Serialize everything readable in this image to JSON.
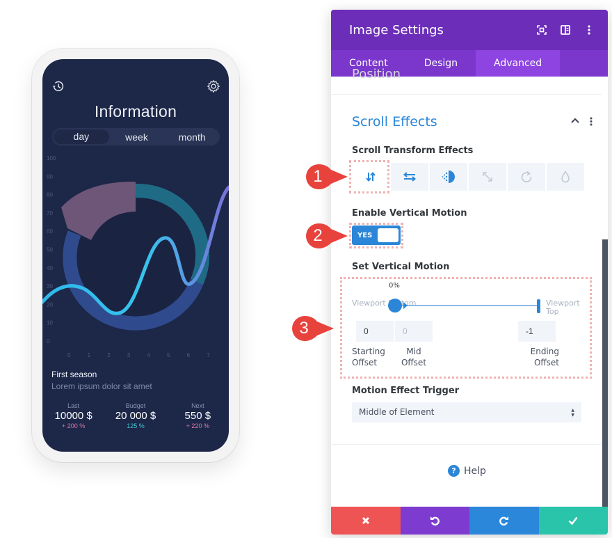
{
  "phone": {
    "title": "Information",
    "icons": {
      "left": "history-icon",
      "right": "gear-icon"
    },
    "segments": [
      {
        "label": "day",
        "active": true
      },
      {
        "label": "week",
        "active": false
      },
      {
        "label": "month",
        "active": false
      }
    ],
    "chart": {
      "y_ticks": [
        "100",
        "90",
        "80",
        "70",
        "60",
        "50",
        "40",
        "30",
        "20",
        "10",
        "0"
      ],
      "x_ticks": [
        "0",
        "1",
        "2",
        "3",
        "4",
        "5",
        "6",
        "7"
      ]
    },
    "season_title": "First season",
    "season_sub": "Lorem ipsum dolor sit amet",
    "stats": [
      {
        "label": "Last",
        "value": "10000 $",
        "change": "+ 200 %",
        "color": "#d97aa8"
      },
      {
        "label": "Budget",
        "value": "20 000 $",
        "change": "125 %",
        "color": "#3fc6d6"
      },
      {
        "label": "Next",
        "value": "550 $",
        "change": "+ 220 %",
        "color": "#d97aa8"
      }
    ]
  },
  "panel": {
    "title": "Image Settings",
    "header_icons": [
      "expand-icon",
      "sidebar-layout-icon",
      "more-vertical-icon"
    ],
    "tabs": [
      {
        "label": "Content",
        "active": false
      },
      {
        "label": "Design",
        "active": false
      },
      {
        "label": "Advanced",
        "active": true
      }
    ],
    "ghost_section": "Position",
    "section_title": "Scroll Effects",
    "transform_label": "Scroll Transform Effects",
    "transform_effects": [
      {
        "name": "vertical-motion",
        "active": true
      },
      {
        "name": "horizontal-motion",
        "active": false
      },
      {
        "name": "fading",
        "active": false
      },
      {
        "name": "scaling",
        "active": false
      },
      {
        "name": "rotating",
        "active": false
      },
      {
        "name": "blur",
        "active": false
      }
    ],
    "enable_label": "Enable Vertical Motion",
    "toggle_label": "YES",
    "set_label": "Set Vertical Motion",
    "slider": {
      "percent_label": "0%",
      "start_caption": "Viewport Bottom",
      "end_caption": "Viewport Top",
      "start_position": 0,
      "end_position": 100
    },
    "offsets": [
      {
        "value": "0",
        "label": "Starting Offset"
      },
      {
        "value": "0",
        "label": "Mid Offset"
      },
      {
        "value": "-1",
        "label": "Ending Offset"
      }
    ],
    "trigger_label": "Motion Effect Trigger",
    "trigger_value": "Middle of Element",
    "help_label": "Help",
    "footer_colors": {
      "cancel": "#ef5455",
      "undo": "#7d3bcf",
      "redo": "#2b87da",
      "save": "#29c4a9"
    }
  },
  "callouts": [
    "1",
    "2",
    "3"
  ]
}
